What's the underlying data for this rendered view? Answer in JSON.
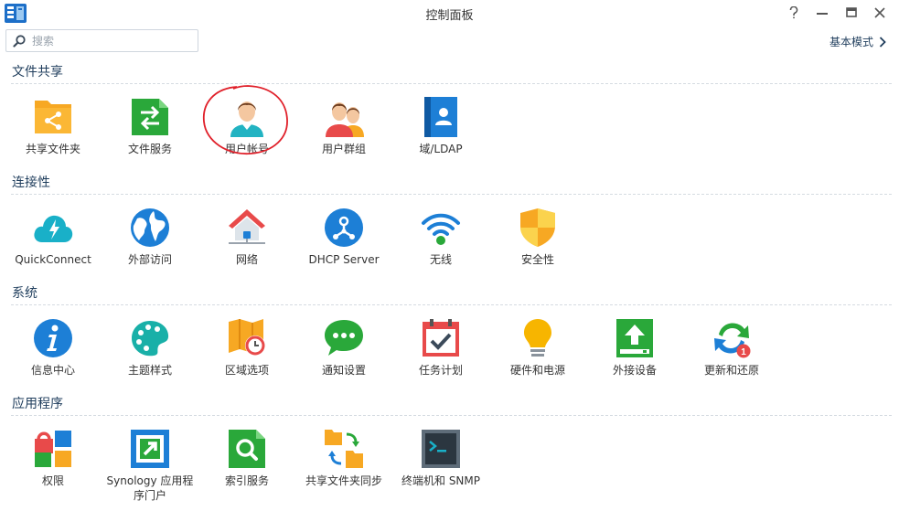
{
  "window": {
    "title": "控制面板"
  },
  "search": {
    "placeholder": "搜索"
  },
  "mode_link": {
    "label": "基本模式"
  },
  "sections": [
    {
      "title": "文件共享",
      "items": [
        {
          "label": "共享文件夹",
          "icon": "shared-folder-icon"
        },
        {
          "label": "文件服务",
          "icon": "file-services-icon"
        },
        {
          "label": "用户帐号",
          "icon": "user-icon"
        },
        {
          "label": "用户群组",
          "icon": "group-icon"
        },
        {
          "label": "域/LDAP",
          "icon": "domain-ldap-icon"
        }
      ]
    },
    {
      "title": "连接性",
      "items": [
        {
          "label": "QuickConnect",
          "icon": "quickconnect-icon"
        },
        {
          "label": "外部访问",
          "icon": "external-access-icon"
        },
        {
          "label": "网络",
          "icon": "network-icon"
        },
        {
          "label": "DHCP Server",
          "icon": "dhcp-server-icon"
        },
        {
          "label": "无线",
          "icon": "wireless-icon"
        },
        {
          "label": "安全性",
          "icon": "security-icon"
        }
      ]
    },
    {
      "title": "系统",
      "items": [
        {
          "label": "信息中心",
          "icon": "info-center-icon"
        },
        {
          "label": "主题样式",
          "icon": "theme-icon"
        },
        {
          "label": "区域选项",
          "icon": "regional-options-icon"
        },
        {
          "label": "通知设置",
          "icon": "notification-icon"
        },
        {
          "label": "任务计划",
          "icon": "task-scheduler-icon"
        },
        {
          "label": "硬件和电源",
          "icon": "hardware-power-icon"
        },
        {
          "label": "外接设备",
          "icon": "external-devices-icon"
        },
        {
          "label": "更新和还原",
          "icon": "update-restore-icon",
          "badge": "1"
        }
      ]
    },
    {
      "title": "应用程序",
      "items": [
        {
          "label": "权限",
          "icon": "privileges-icon"
        },
        {
          "label": "Synology 应用程序门户",
          "icon": "application-portal-icon"
        },
        {
          "label": "索引服务",
          "icon": "indexing-service-icon"
        },
        {
          "label": "共享文件夹同步",
          "icon": "shared-folder-sync-icon"
        },
        {
          "label": "终端机和 SNMP",
          "icon": "terminal-snmp-icon"
        }
      ]
    }
  ],
  "colors": {
    "accent": "#1f3d5c",
    "annotation": "#e0202a"
  }
}
